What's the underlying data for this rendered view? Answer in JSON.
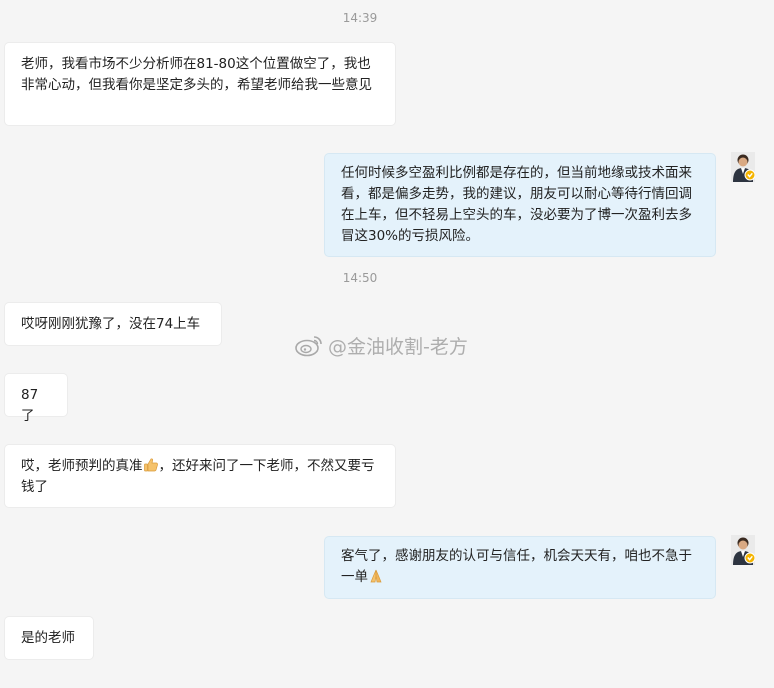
{
  "messages": [
    {
      "type": "time",
      "text": "14:39"
    },
    {
      "type": "in",
      "text": "老师，我看市场不少分析师在81-80这个位置做空了，我也非常心动，但我看你是坚定多头的，希望老师给我一些意见"
    },
    {
      "type": "out",
      "text": "任何时候多空盈利比例都是存在的，但当前地缘或技术面来看，都是偏多走势，我的建议，朋友可以耐心等待行情回调在上车，但不轻易上空头的车，没必要为了博一次盈利去多冒这30%的亏损风险。"
    },
    {
      "type": "time",
      "text": "14:50"
    },
    {
      "type": "in",
      "text": "哎呀刚刚犹豫了，没在74上车"
    },
    {
      "type": "in",
      "text": "87了"
    },
    {
      "type": "in",
      "text_before": "哎，老师预判的真准",
      "emoji": "thumbs-up-emoji",
      "text_after": "，还好来问了一下老师，不然又要亏钱了"
    },
    {
      "type": "out",
      "text_before": "客气了，感谢朋友的认可与信任，机会天天有，咱也不急于一单",
      "emoji": "praying-hands-emoji"
    },
    {
      "type": "in",
      "text": "是的老师"
    }
  ],
  "watermark": {
    "text": "@金油收割-老方",
    "icon": "weibo-icon"
  },
  "avatar": {
    "icon": "user-avatar",
    "badge": "verified-badge",
    "badge_color": "#f4b400"
  },
  "colors": {
    "outgoing_bubble": "#e4f2fb",
    "incoming_bubble": "#ffffff",
    "background": "#f5f5f5"
  }
}
